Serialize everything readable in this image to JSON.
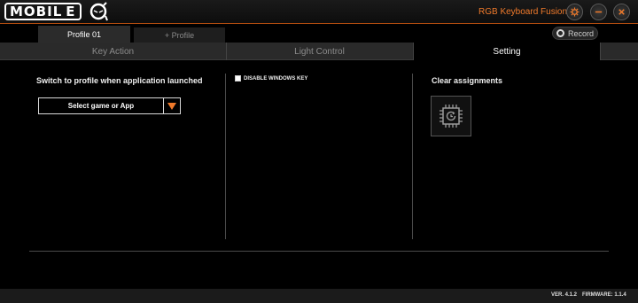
{
  "titlebar": {
    "logo_text": "MOBIL E",
    "app_title": "RGB Keyboard Fusion",
    "accent_color": "#f07a2b",
    "icons": [
      "settings-icon",
      "minimize-icon",
      "close-icon"
    ]
  },
  "profiles": {
    "active_label": "Profile 01",
    "add_label": "+ Profile"
  },
  "record": {
    "label": "Record"
  },
  "tabs": [
    {
      "label": "Key Action",
      "active": false
    },
    {
      "label": "Light Control",
      "active": false
    },
    {
      "label": "Setting",
      "active": true
    }
  ],
  "setting": {
    "switch_label": "Switch to profile when application launched",
    "select_value": "Select game or App",
    "disable_win_key_label": "DISABLE WINDOWS KEY",
    "disable_win_key_checked": false,
    "clear_label": "Clear assignments"
  },
  "footer": {
    "version": "VER. 4.1.2",
    "firmware": "FIRMWARE: 1.1.4"
  }
}
